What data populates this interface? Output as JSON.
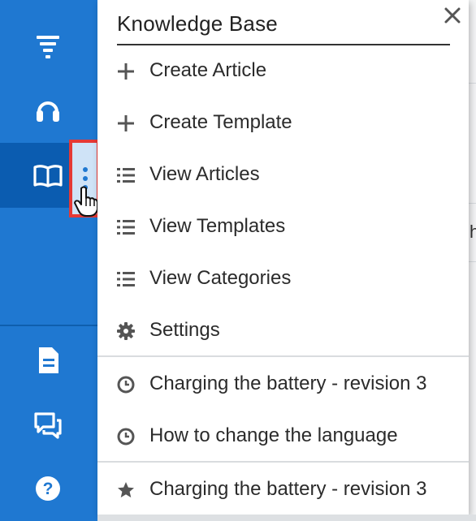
{
  "menu": {
    "title": "Knowledge Base",
    "items": [
      {
        "label": "Create Article",
        "icon": "plus-icon"
      },
      {
        "label": "Create Template",
        "icon": "plus-icon"
      },
      {
        "label": "View Articles",
        "icon": "list-icon"
      },
      {
        "label": "View Templates",
        "icon": "list-icon"
      },
      {
        "label": "View Categories",
        "icon": "list-icon"
      },
      {
        "label": "Settings",
        "icon": "gear-icon"
      }
    ],
    "recently_viewed": [
      {
        "label": "Charging the battery - revision 3",
        "icon": "clock-icon"
      },
      {
        "label": "How to change the language",
        "icon": "clock-icon"
      }
    ],
    "favorites": [
      {
        "label": "Charging the battery - revision 3",
        "icon": "star-icon"
      }
    ]
  },
  "background": {
    "partial_text": "h"
  },
  "sidebar": {
    "items": [
      {
        "name": "filter-icon"
      },
      {
        "name": "headset-icon"
      },
      {
        "name": "book-icon",
        "active": true
      },
      {
        "name": "document-icon"
      },
      {
        "name": "chat-icon"
      },
      {
        "name": "help-icon"
      }
    ]
  },
  "colors": {
    "sidebar": "#1f78d1",
    "sidebar_active": "#0b5cb0",
    "highlight_border": "#e53935",
    "menu_text": "#2b2b2b"
  }
}
